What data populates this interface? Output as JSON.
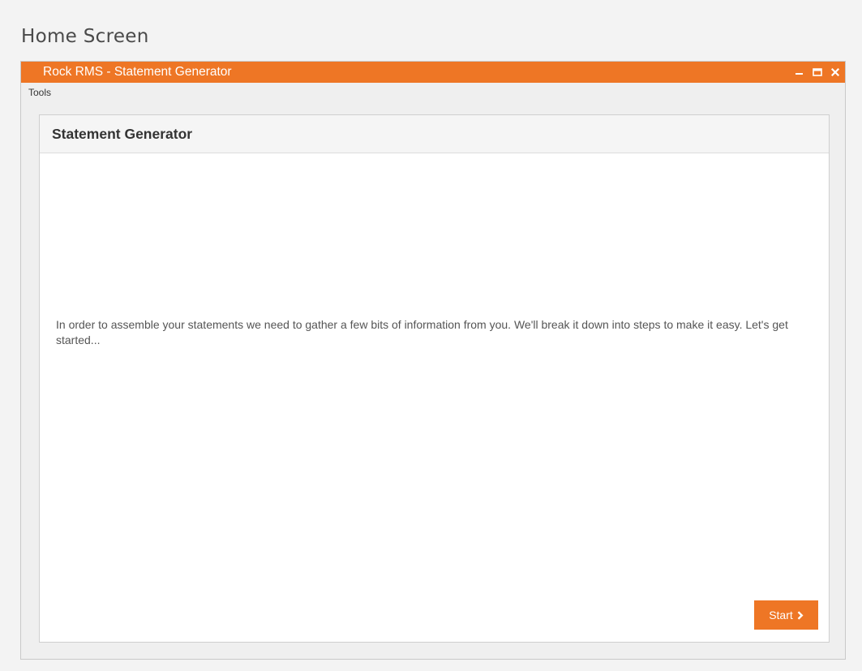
{
  "page": {
    "title": "Home Screen"
  },
  "window": {
    "title": "Rock RMS - Statement Generator",
    "accent_color": "#ee7625",
    "controls": [
      "minimize-icon",
      "maximize-icon",
      "close-icon"
    ]
  },
  "menu": {
    "items": [
      {
        "label": "Tools"
      }
    ]
  },
  "panel": {
    "heading": "Statement Generator",
    "intro": "In order to assemble your statements we need to gather a few bits of information from you. We'll break it down into steps to make it easy. Let's get started..."
  },
  "actions": {
    "start_label": "Start",
    "start_icon": "chevron-right-icon"
  }
}
